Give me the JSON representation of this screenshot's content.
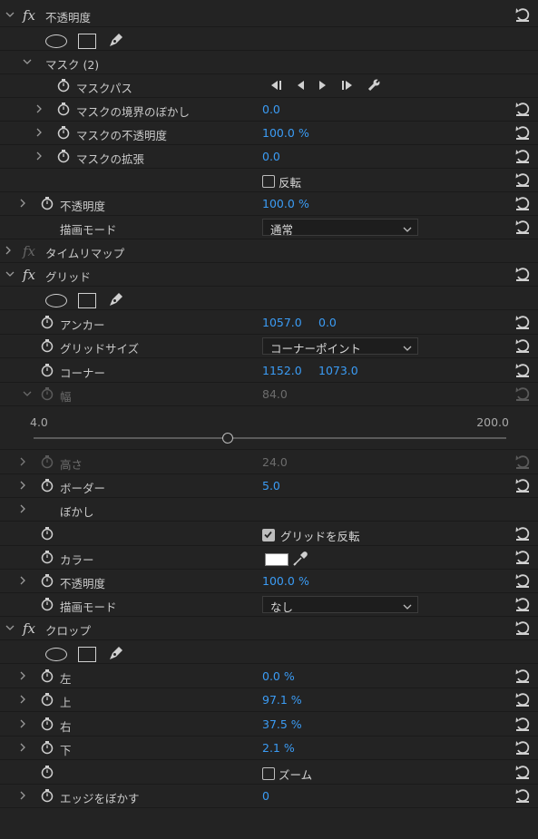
{
  "opacity_effect": {
    "title": "不透明度",
    "mask": {
      "title": "マスク (2)",
      "path_label": "マスクパス",
      "feather_label": "マスクの境界のぼかし",
      "feather_value": "0.0",
      "opacity_label": "マスクの不透明度",
      "opacity_value": "100.0",
      "opacity_unit": "%",
      "expansion_label": "マスクの拡張",
      "expansion_value": "0.0",
      "invert_label": "反転",
      "invert_checked": false
    },
    "opacity_label": "不透明度",
    "opacity_value": "100.0",
    "opacity_unit": "%",
    "blend_label": "描画モード",
    "blend_value": "通常"
  },
  "time_remap": {
    "title": "タイムリマップ"
  },
  "grid_effect": {
    "title": "グリッド",
    "anchor_label": "アンカー",
    "anchor_x": "1057.0",
    "anchor_y": "0.0",
    "grid_size_label": "グリッドサイズ",
    "grid_size_value": "コーナーポイント",
    "corner_label": "コーナー",
    "corner_x": "1152.0",
    "corner_y": "1073.0",
    "width_label": "幅",
    "width_value": "84.0",
    "slider_min": "4.0",
    "slider_max": "200.0",
    "slider_fraction": 0.41,
    "height_label": "高さ",
    "height_value": "24.0",
    "border_label": "ボーダー",
    "border_value": "5.0",
    "feather_label": "ぼかし",
    "invert_label": "グリッドを反転",
    "invert_checked": true,
    "color_label": "カラー",
    "color_value": "#ffffff",
    "opacity_label": "不透明度",
    "opacity_value": "100.0",
    "opacity_unit": "%",
    "blend_label": "描画モード",
    "blend_value": "なし"
  },
  "crop_effect": {
    "title": "クロップ",
    "left_label": "左",
    "left_value": "0.0 %",
    "top_label": "上",
    "top_value": "97.1 %",
    "right_label": "右",
    "right_value": "37.5 %",
    "bottom_label": "下",
    "bottom_value": "2.1 %",
    "zoom_label": "ズーム",
    "zoom_checked": false,
    "edge_label": "エッジをぼかす",
    "edge_value": "0"
  },
  "colors": {
    "value_blue": "#3b9cf5",
    "panel_bg": "#232323"
  }
}
